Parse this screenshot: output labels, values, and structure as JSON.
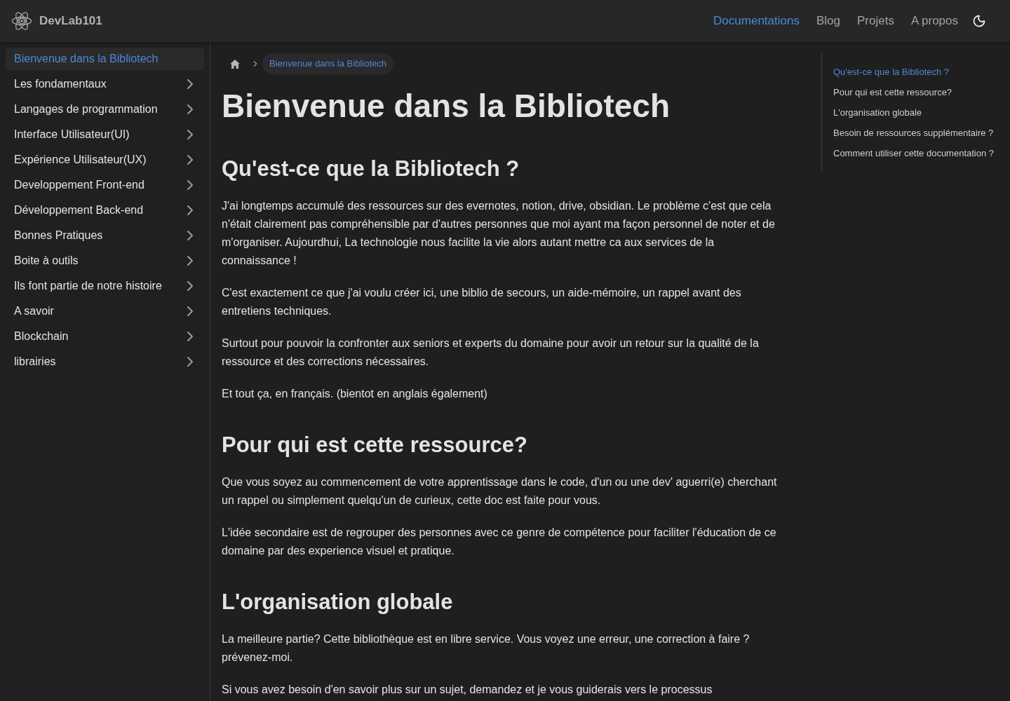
{
  "header": {
    "logo_text": "DevLab101",
    "nav": [
      {
        "label": "Documentations",
        "selected": true
      },
      {
        "label": "Blog",
        "selected": false
      },
      {
        "label": "Projets",
        "selected": false
      },
      {
        "label": "A propos",
        "selected": false
      }
    ]
  },
  "sidebar": {
    "items": [
      {
        "label": "Bienvenue dans la Bibliotech",
        "selected": true,
        "expandable": false
      },
      {
        "label": "Les fondamentaux",
        "selected": false,
        "expandable": true
      },
      {
        "label": "Langages de programmation",
        "selected": false,
        "expandable": true
      },
      {
        "label": "Interface Utilisateur(UI)",
        "selected": false,
        "expandable": true
      },
      {
        "label": "Expérience Utilisateur(UX)",
        "selected": false,
        "expandable": true
      },
      {
        "label": "Developpement Front-end",
        "selected": false,
        "expandable": true
      },
      {
        "label": "Développement Back-end",
        "selected": false,
        "expandable": true
      },
      {
        "label": "Bonnes Pratiques",
        "selected": false,
        "expandable": true
      },
      {
        "label": "Boite à outils",
        "selected": false,
        "expandable": true
      },
      {
        "label": "Ils font partie de notre histoire",
        "selected": false,
        "expandable": true
      },
      {
        "label": "A savoir",
        "selected": false,
        "expandable": true
      },
      {
        "label": "Blockchain",
        "selected": false,
        "expandable": true
      },
      {
        "label": "librairies",
        "selected": false,
        "expandable": true
      }
    ]
  },
  "breadcrumb": {
    "current": "Bienvenue dans la Bibliotech"
  },
  "article": {
    "title": "Bienvenue dans la Bibliotech",
    "sections": [
      {
        "heading": "Qu'est-ce que la Bibliotech ?",
        "paragraphs": [
          "J'ai longtemps accumulé des ressources sur des evernotes, notion, drive, obsidian. Le problème c'est que cela n'était clairement pas compréhensible par d'autres personnes que moi ayant ma façon personnel de noter et de m'organiser. Aujourdhui, La technologie nous facilite la vie alors autant mettre ca aux services de la connaissance !",
          "C'est exactement ce que j'ai voulu créer ici, une biblio de secours, un aide-mémoire, un rappel avant des entretiens techniques.",
          "Surtout pour pouvoir la confronter aux seniors et experts du domaine pour avoir un retour sur la qualité de la ressource et des corrections nécessaires.",
          "Et tout ça, en français. (bientot en anglais également)"
        ]
      },
      {
        "heading": "Pour qui est cette ressource?",
        "paragraphs": [
          "Que vous soyez au commencement de votre apprentissage dans le code, d'un ou une dev' aguerri(e) cherchant un rappel ou simplement quelqu'un de curieux, cette doc est faite pour vous.",
          "L'idée secondaire est de regrouper des personnes avec ce genre de compétence pour faciliter l'éducation de ce domaine par des experience visuel et pratique."
        ]
      },
      {
        "heading": "L'organisation globale",
        "paragraphs": [
          "La meilleure partie? Cette bibliothèque est en libre service. Vous voyez une erreur, une correction à faire ? prévenez-moi.",
          "Si vous avez besoin d'en savoir plus sur un sujet, demandez et je vous guiderais vers le processus"
        ]
      }
    ]
  },
  "toc": {
    "items": [
      {
        "label": "Qu'est-ce que la Bibliotech ?",
        "selected": true
      },
      {
        "label": "Pour qui est cette ressource?",
        "selected": false
      },
      {
        "label": "L'organisation globale",
        "selected": false
      },
      {
        "label": "Besoin de ressources supplémentaire ?",
        "selected": false
      },
      {
        "label": "Comment utiliser cette documentation ?",
        "selected": false
      }
    ]
  }
}
